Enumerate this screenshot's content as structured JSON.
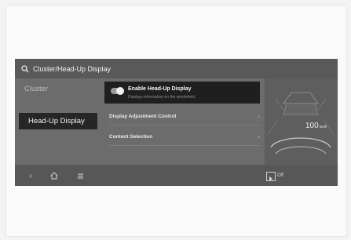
{
  "header": {
    "title": "Cluster/Head-Up Display",
    "icon": "search-icon"
  },
  "sidebar": {
    "items": [
      {
        "label": "Cluster",
        "active": false
      },
      {
        "label": "Head-Up Display",
        "active": true
      }
    ]
  },
  "settings": {
    "enable_hud": {
      "title": "Enable Head-Up Display",
      "description": "Displays information on the windshield.",
      "enabled": true
    },
    "display_adjustment": "Display Adjustment Control",
    "content_selection": "Content Selection"
  },
  "preview": {
    "speed": "100",
    "speed_unit": "km/h"
  },
  "bottombar": {
    "back_icon": "back-icon",
    "home_icon": "home-icon",
    "menu_icon": "menu-icon",
    "off_label": "Off"
  }
}
